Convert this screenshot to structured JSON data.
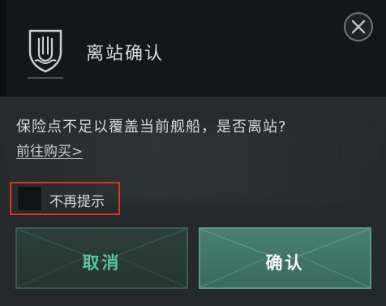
{
  "dialog": {
    "title": "离站确认",
    "emblem_icon": "shield-emblem-icon",
    "close_icon": "close-icon"
  },
  "message": {
    "text": "保险点不足以覆盖当前舰船，是否离站?",
    "buy_link": "前往购买>"
  },
  "option": {
    "checked": false,
    "label": "不再提示"
  },
  "buttons": {
    "cancel_label": "取消",
    "confirm_label": "确认"
  },
  "colors": {
    "highlight_frame": "#e0302b",
    "cancel_text": "#5fc2a4",
    "confirm_bg": "#447668"
  }
}
